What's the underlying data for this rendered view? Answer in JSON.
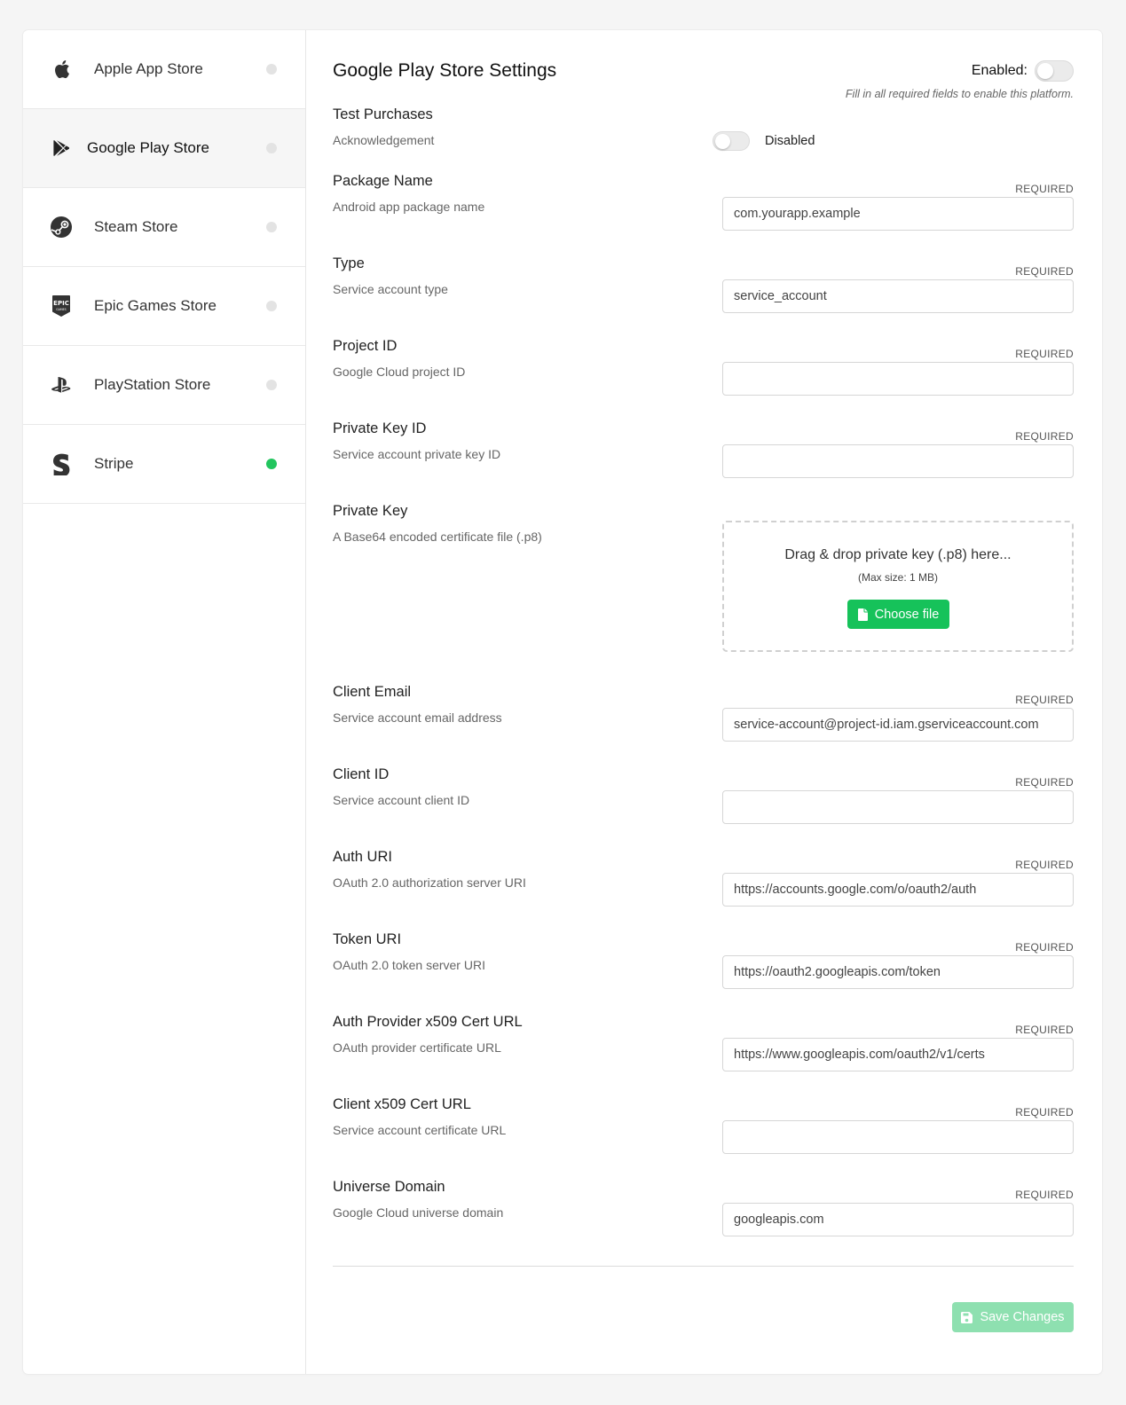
{
  "sidebar": {
    "items": [
      {
        "label": "Apple App Store",
        "icon": "apple-icon",
        "active": false,
        "status": "inactive"
      },
      {
        "label": "Google Play Store",
        "icon": "google-play-icon",
        "active": true,
        "status": "inactive"
      },
      {
        "label": "Steam Store",
        "icon": "steam-icon",
        "active": false,
        "status": "inactive"
      },
      {
        "label": "Epic Games Store",
        "icon": "epic-games-icon",
        "active": false,
        "status": "inactive"
      },
      {
        "label": "PlayStation Store",
        "icon": "playstation-icon",
        "active": false,
        "status": "inactive"
      },
      {
        "label": "Stripe",
        "icon": "stripe-icon",
        "active": false,
        "status": "active"
      }
    ],
    "status_colors": {
      "inactive": "#e3e3e3",
      "active": "#22c55e"
    }
  },
  "header": {
    "title": "Google Play Store Settings",
    "enabled_label": "Enabled:",
    "enabled_hint": "Fill in all required fields to enable this platform."
  },
  "test_purchases": {
    "title": "Test Purchases",
    "description": "Acknowledgement",
    "status": "Disabled"
  },
  "required_label": "REQUIRED",
  "fields": [
    {
      "title": "Package Name",
      "description": "Android app package name",
      "value": "com.yourapp.example"
    },
    {
      "title": "Type",
      "description": "Service account type",
      "value": "service_account"
    },
    {
      "title": "Project ID",
      "description": "Google Cloud project ID",
      "value": ""
    },
    {
      "title": "Private Key ID",
      "description": "Service account private key ID",
      "value": ""
    }
  ],
  "private_key": {
    "title": "Private Key",
    "description": "A Base64 encoded certificate file (.p8)",
    "drop_text": "Drag & drop private key (.p8) here...",
    "max_size": "(Max size: 1 MB)",
    "button_label": "Choose file"
  },
  "fields2": [
    {
      "title": "Client Email",
      "description": "Service account email address",
      "value": "service-account@project-id.iam.gserviceaccount.com"
    },
    {
      "title": "Client ID",
      "description": "Service account client ID",
      "value": ""
    },
    {
      "title": "Auth URI",
      "description": "OAuth 2.0 authorization server URI",
      "value": "https://accounts.google.com/o/oauth2/auth"
    },
    {
      "title": "Token URI",
      "description": "OAuth 2.0 token server URI",
      "value": "https://oauth2.googleapis.com/token"
    },
    {
      "title": "Auth Provider x509 Cert URL",
      "description": "OAuth provider certificate URL",
      "value": "https://www.googleapis.com/oauth2/v1/certs"
    },
    {
      "title": "Client x509 Cert URL",
      "description": "Service account certificate URL",
      "value": ""
    },
    {
      "title": "Universe Domain",
      "description": "Google Cloud universe domain",
      "value": "googleapis.com"
    }
  ],
  "save_button": {
    "label": "Save Changes",
    "icon": "save-icon"
  },
  "colors": {
    "accent": "#16c25a",
    "save_disabled": "#8ee0b0"
  }
}
